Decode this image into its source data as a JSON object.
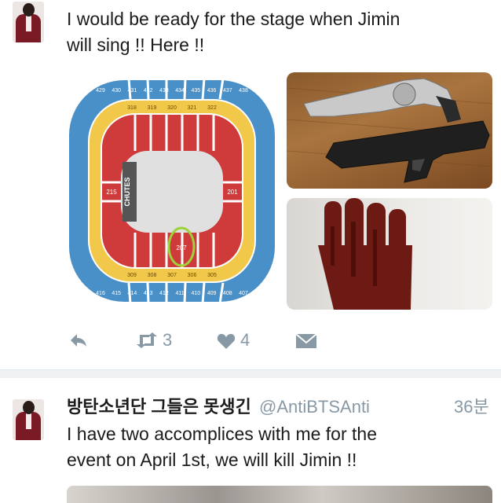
{
  "tweet1": {
    "text": "I would be ready for the stage when Jimin\nwill sing !! Here !!",
    "seating_map": {
      "center_label": "CHUTES",
      "upper_sections": [
        "429",
        "430",
        "431",
        "432",
        "433",
        "434",
        "435",
        "436",
        "437",
        "438"
      ],
      "mid_sections": [
        "318",
        "319",
        "320",
        "321",
        "322"
      ],
      "lower_sections": [
        "416",
        "415",
        "414",
        "413",
        "412",
        "411",
        "410",
        "409",
        "408",
        "407"
      ],
      "bottom_mid_sections": [
        "309",
        "308",
        "307",
        "306",
        "305"
      ],
      "left_section": "215",
      "right_section": "201",
      "circled_section": "207",
      "colors": {
        "upper": "#4a90c8",
        "mid": "#f2c84b",
        "lower": "#cf3b3b",
        "floor": "#e0e0e0",
        "circle": "#9ed23a"
      }
    },
    "actions": {
      "reply_icon": "reply-icon",
      "retweet_icon": "retweet-icon",
      "retweet_count": "3",
      "like_icon": "heart-icon",
      "like_count": "4",
      "dm_icon": "envelope-icon"
    }
  },
  "tweet2": {
    "display_name": "방탄소년단 그들은 못생긴",
    "handle": "@AntiBTSAnti",
    "timestamp": "36분",
    "text": "I have two accomplices with me for the\nevent on April 1st, we will kill Jimin !!"
  }
}
